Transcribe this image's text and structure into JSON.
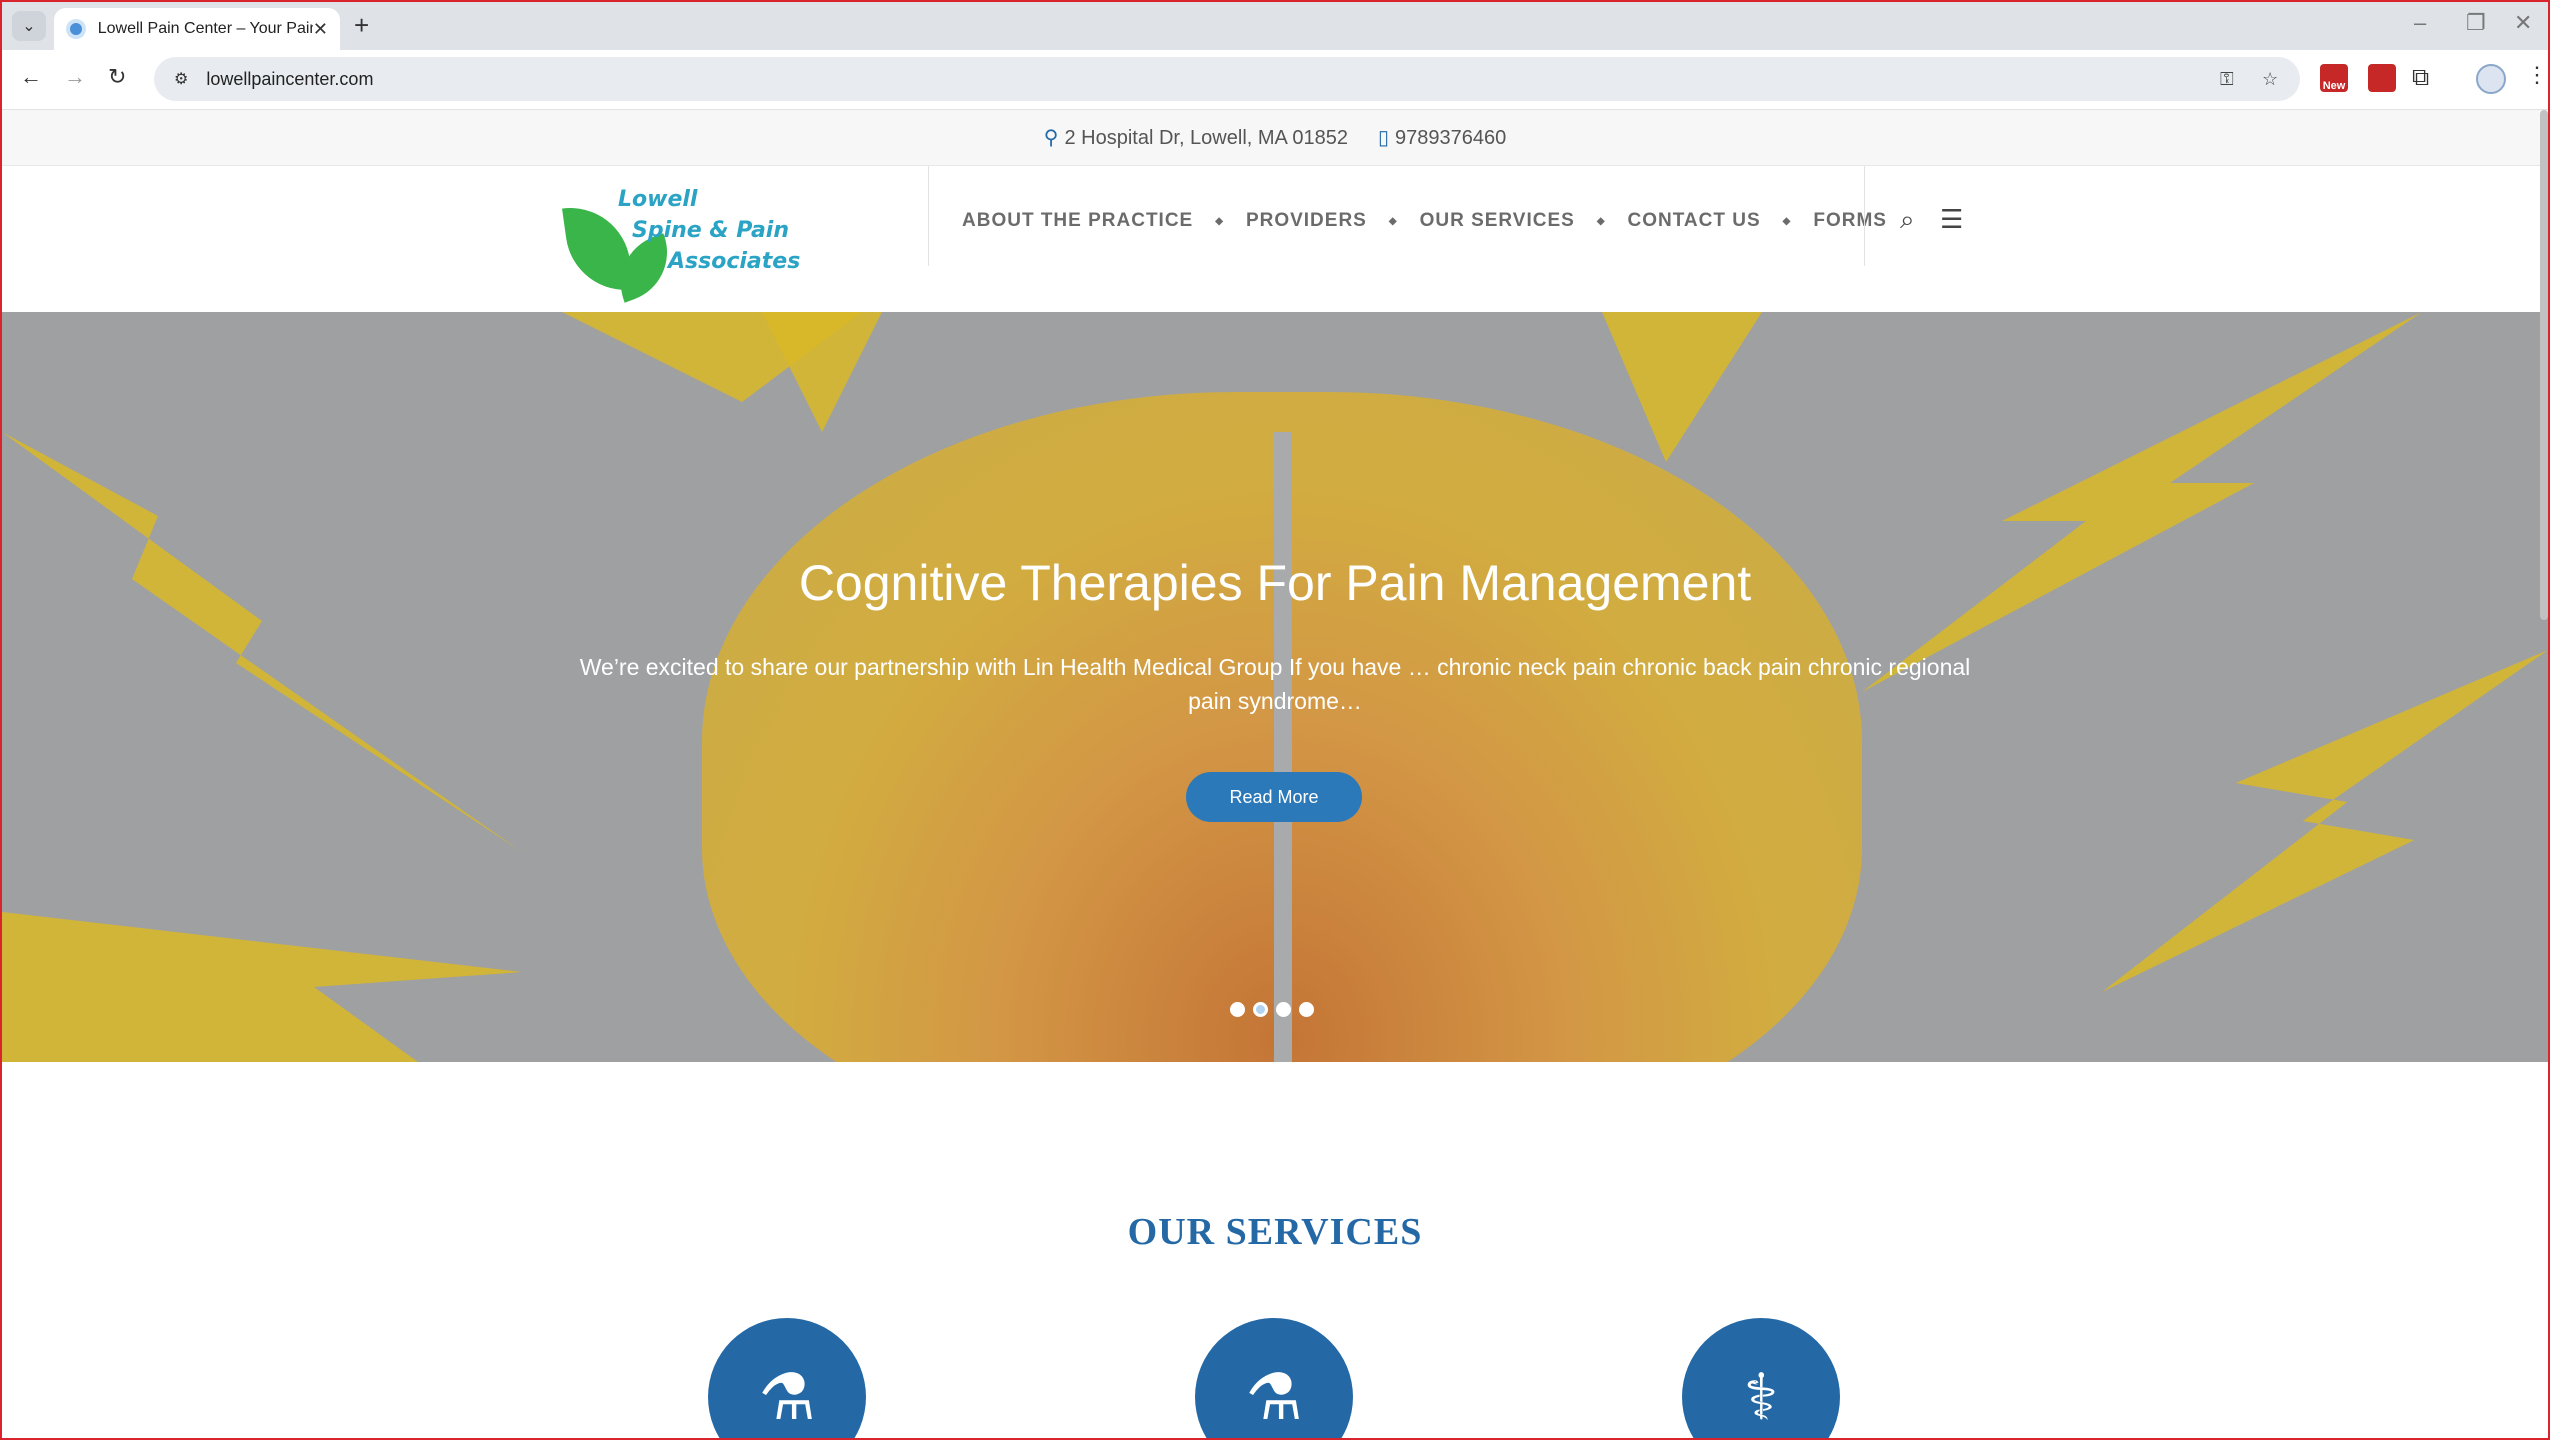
{
  "browser": {
    "tab_title": "Lowell Pain Center – Your Pain...",
    "url": "lowellpaincenter.com",
    "ext_badge": "New"
  },
  "contact": {
    "address": "2 Hospital Dr, Lowell, MA 01852",
    "phone": "9789376460"
  },
  "logo": {
    "line1": "Lowell",
    "line2": "Spine & Pain",
    "line3": "Associates"
  },
  "nav": {
    "items": [
      {
        "label": "ABOUT THE PRACTICE"
      },
      {
        "label": "PROVIDERS"
      },
      {
        "label": "OUR SERVICES"
      },
      {
        "label": "CONTACT US"
      },
      {
        "label": "FORMS"
      }
    ]
  },
  "hero": {
    "title": "Cognitive Therapies For Pain Management",
    "text": "We’re excited to share our partnership with Lin Health Medical Group If you have … chronic neck pain chronic back pain chronic regional pain syndrome…",
    "button": "Read More",
    "active_slide": 2,
    "slide_count": 4
  },
  "services": {
    "title": "OUR SERVICES"
  },
  "colors": {
    "brand_blue": "#2469a6",
    "button_blue": "#2b79b9",
    "logo_green": "#39b54a",
    "logo_teal": "#2aa3c4"
  },
  "icons": [
    "mortar-pestle-icon",
    "mortar-pestle-icon",
    "doctor-icon"
  ]
}
